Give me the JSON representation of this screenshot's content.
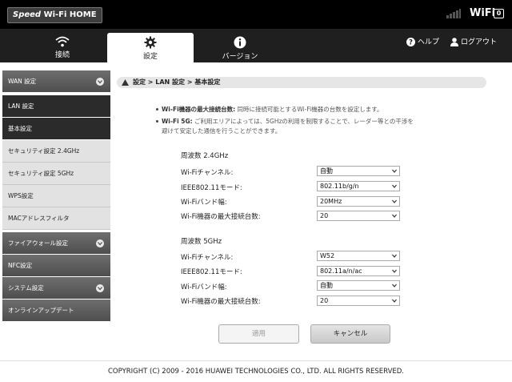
{
  "header": {
    "logo_speed": "Speed",
    "logo_rest": " Wi-Fi HOME",
    "wifi_mark": "WiFi",
    "wifi_sub": "0"
  },
  "nav": {
    "tabs": [
      {
        "label": "接続",
        "icon": "wifi-icon"
      },
      {
        "label": "設定",
        "icon": "gear-icon",
        "active": true
      },
      {
        "label": "バージョン",
        "icon": "info-icon"
      }
    ],
    "help": "ヘルプ",
    "logout": "ログアウト"
  },
  "sidebar": {
    "items": [
      {
        "label": "WAN 設定",
        "style": "dark",
        "expandable": true
      },
      {
        "label": "LAN 設定",
        "style": "darkest"
      },
      {
        "label": "基本設定",
        "style": "darkest"
      },
      {
        "label": "セキュリティ設定 2.4GHz",
        "style": "light"
      },
      {
        "label": "セキュリティ設定 5GHz",
        "style": "light"
      },
      {
        "label": "WPS設定",
        "style": "light"
      },
      {
        "label": "MACアドレスフィルタ",
        "style": "light"
      },
      {
        "label": "ファイアウォール設定",
        "style": "dark",
        "expandable": true
      },
      {
        "label": "NFC設定",
        "style": "dark"
      },
      {
        "label": "システム設定",
        "style": "dark",
        "expandable": true
      },
      {
        "label": "オンラインアップデート",
        "style": "dark"
      }
    ]
  },
  "breadcrumb": "設定 > LAN 設定 > 基本設定",
  "notes": [
    {
      "bold": "Wi-Fi機器の最大接続台数:",
      "text": " 同時に接続可能とするWi-Fi機器の台数を設定します。"
    },
    {
      "bold": "Wi-Fi 5G:",
      "text": " ご利用エリアによっては、5GHzの利用を制限することで、レーダー等との干渉を",
      "text2": "避けて安定した通信を行うことができます。"
    }
  ],
  "band24": {
    "title": "周波数 2.4GHz",
    "rows": [
      {
        "label": "Wi-Fiチャンネル:",
        "value": "自動"
      },
      {
        "label": "IEEE802.11モード:",
        "value": "802.11b/g/n"
      },
      {
        "label": "Wi-Fiバンド幅:",
        "value": "20MHz"
      },
      {
        "label": "Wi-Fi機器の最大接続台数:",
        "value": "20"
      }
    ]
  },
  "band5": {
    "title": "周波数 5GHz",
    "rows": [
      {
        "label": "Wi-Fiチャンネル:",
        "value": "W52"
      },
      {
        "label": "IEEE802.11モード:",
        "value": "802.11a/n/ac"
      },
      {
        "label": "Wi-Fiバンド幅:",
        "value": "自動"
      },
      {
        "label": "Wi-Fi機器の最大接続台数:",
        "value": "20"
      }
    ]
  },
  "buttons": {
    "apply": "適用",
    "cancel": "キャンセル"
  },
  "footer": "COPYRIGHT (C) 2009 - 2016 HUAWEI TECHNOLOGIES CO., LTD. ALL RIGHTS RESERVED."
}
